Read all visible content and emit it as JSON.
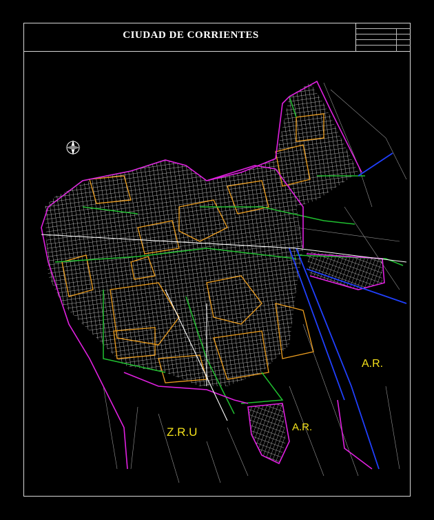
{
  "title": "CIUDAD DE CORRIENTES",
  "cartouche": {
    "rows": [
      "",
      "",
      "",
      "",
      ""
    ]
  },
  "zones": {
    "zru": "Z.R.U",
    "ar_right": "A.R.",
    "ar_center": "A.R."
  },
  "colors": {
    "background": "#000000",
    "frame": "#d8d8d8",
    "streets": "#e8e8e8",
    "magenta_boundary": "#e020e0",
    "orange_blocks": "#f0a020",
    "green_boundary": "#20c030",
    "blue_road": "#2040ff",
    "zone_label": "#f5e21b"
  },
  "icons": [
    "north-arrow-icon"
  ]
}
